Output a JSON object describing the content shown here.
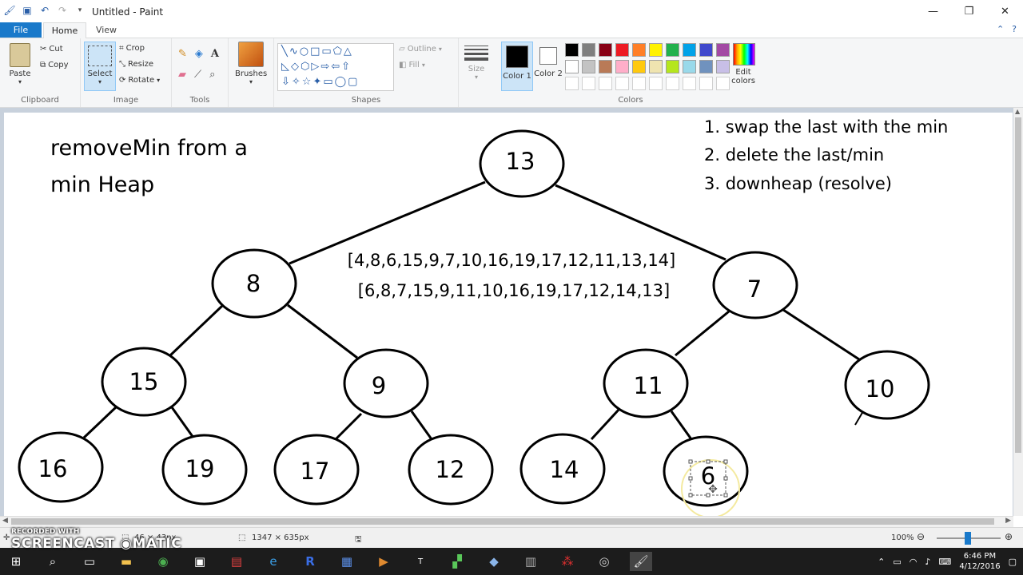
{
  "window": {
    "title": "Untitled - Paint"
  },
  "tabs": {
    "file": "File",
    "home": "Home",
    "view": "View"
  },
  "ribbon": {
    "clipboard": {
      "paste": "Paste",
      "cut": "Cut",
      "copy": "Copy",
      "label": "Clipboard"
    },
    "image": {
      "select": "Select",
      "crop": "Crop",
      "resize": "Resize",
      "rotate": "Rotate",
      "label": "Image"
    },
    "tools": {
      "label": "Tools"
    },
    "brushes": {
      "label": "Brushes"
    },
    "shapes": {
      "outline": "Outline",
      "fill": "Fill",
      "label": "Shapes"
    },
    "size": {
      "label": "Size"
    },
    "color1": {
      "label": "Color 1",
      "value": "#000000"
    },
    "color2": {
      "label": "Color 2",
      "value": "#ffffff"
    },
    "colors": {
      "label": "Colors",
      "edit": "Edit colors",
      "palette": [
        "#000000",
        "#7f7f7f",
        "#880015",
        "#ed1c24",
        "#ff7f27",
        "#fff200",
        "#22b14c",
        "#00a2e8",
        "#3f48cc",
        "#a349a4",
        "#ffffff",
        "#c3c3c3",
        "#b97a57",
        "#ffaec9",
        "#ffc90e",
        "#efe4b0",
        "#b5e61d",
        "#99d9ea",
        "#7092be",
        "#c8bfe7",
        "#ffffff",
        "#ffffff",
        "#ffffff",
        "#ffffff",
        "#ffffff",
        "#ffffff",
        "#ffffff",
        "#ffffff",
        "#ffffff",
        "#ffffff"
      ]
    }
  },
  "canvas": {
    "heading_line1": "removeMin from a",
    "heading_line2": "min Heap",
    "steps": [
      "1. swap the last with the min",
      "2. delete the last/min",
      "3. downheap (resolve)"
    ],
    "array_before": "[4,8,6,15,9,7,10,16,19,17,12,11,13,14]",
    "array_after": "[6,8,7,15,9,11,10,16,19,17,12,14,13]",
    "nodes": [
      "13",
      "8",
      "7",
      "15",
      "9",
      "11",
      "10",
      "16",
      "19",
      "17",
      "12",
      "14",
      "6"
    ]
  },
  "status": {
    "selection_size": "46 × 43px",
    "canvas_size": "1347 × 635px",
    "zoom": "100%"
  },
  "watermark": {
    "line1": "RECORDED WITH",
    "line2": "SCREENCAST",
    "line3": "MATIC"
  },
  "taskbar": {
    "time": "6:46 PM",
    "date": "4/12/2016"
  }
}
